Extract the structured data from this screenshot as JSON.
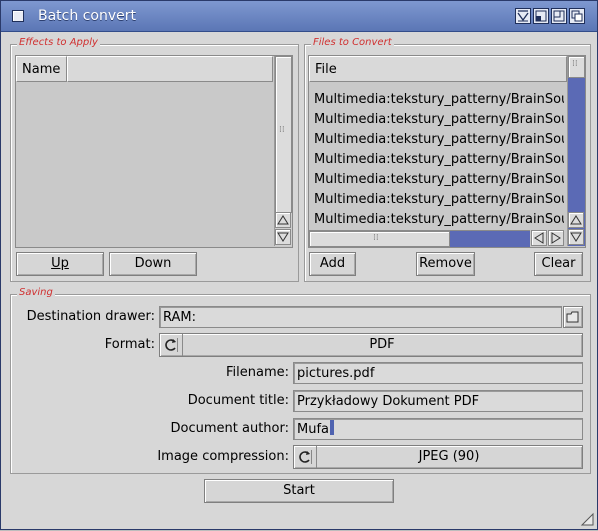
{
  "window": {
    "title": "Batch convert"
  },
  "effects": {
    "group_label": "Effects to Apply",
    "column_header": "Name",
    "up_label": "Up",
    "down_label": "Down"
  },
  "files": {
    "group_label": "Files to Convert",
    "column_header": "File",
    "rows": [
      "Multimedia:tekstury_patterny/BrainSou",
      "Multimedia:tekstury_patterny/BrainSou",
      "Multimedia:tekstury_patterny/BrainSou",
      "Multimedia:tekstury_patterny/BrainSou",
      "Multimedia:tekstury_patterny/BrainSou",
      "Multimedia:tekstury_patterny/BrainSou",
      "Multimedia:tekstury_patterny/BrainSou"
    ],
    "add_label": "Add",
    "remove_label": "Remove",
    "clear_label": "Clear"
  },
  "saving": {
    "group_label": "Saving",
    "destination_label": "Destination drawer:",
    "destination_value": "RAM:",
    "format_label": "Format:",
    "format_value": "PDF",
    "filename_label": "Filename:",
    "filename_value": "pictures.pdf",
    "doc_title_label": "Document title:",
    "doc_title_value": "Przykładowy Dokument PDF",
    "doc_author_label": "Document author:",
    "doc_author_value": "Mufa",
    "image_compression_label": "Image compression:",
    "image_compression_value": "JPEG (90)"
  },
  "start_label": "Start",
  "colors": {
    "accent": "#5b6ab5",
    "group_label": "#d03030"
  }
}
